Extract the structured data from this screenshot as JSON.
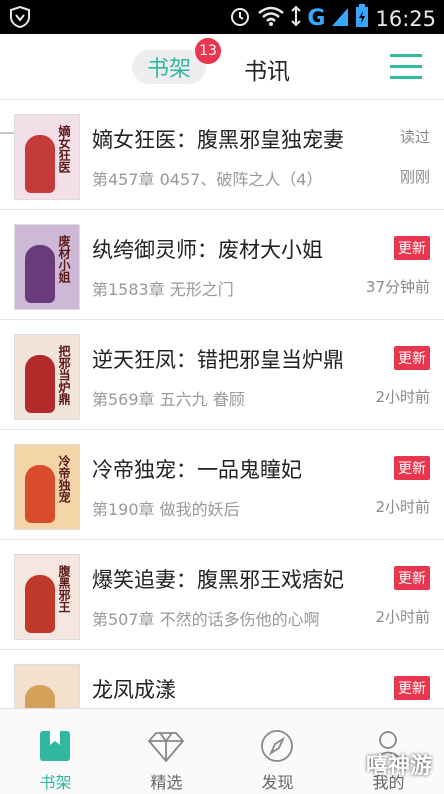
{
  "status_bar": {
    "time": "16:25",
    "network": "G"
  },
  "header": {
    "tab_shelf": "书架",
    "tab_shelf_badge": "13",
    "tab_news": "书讯"
  },
  "books": [
    {
      "title": "嫡女狂医：腹黑邪皇独宠妻",
      "chapter": "第457章 0457、破阵之人（4）",
      "tag": "读过",
      "tag_type": "read",
      "time": "刚刚",
      "cover_text": "嫡女狂医",
      "cover_color": "#f3dfe7"
    },
    {
      "title": "纨绔御灵师：废材大小姐",
      "chapter": "第1583章 无形之门",
      "tag": "更新",
      "tag_type": "new",
      "time": "37分钟前",
      "cover_text": "废材小姐",
      "cover_color": "#cdb8d6"
    },
    {
      "title": "逆天狂凤：错把邪皇当炉鼎",
      "chapter": "第569章 五六九 眷顾",
      "tag": "更新",
      "tag_type": "new",
      "time": "2小时前",
      "cover_text": "把邪当炉鼎",
      "cover_color": "#f2e3db"
    },
    {
      "title": "冷帝独宠：一品鬼瞳妃",
      "chapter": "第190章 做我的妖后",
      "tag": "更新",
      "tag_type": "new",
      "time": "2小时前",
      "cover_text": "冷帝独宠",
      "cover_color": "#f3d5a8"
    },
    {
      "title": "爆笑追妻：腹黑邪王戏痞妃",
      "chapter": "第507章 不然的话多伤他的心啊",
      "tag": "更新",
      "tag_type": "new",
      "time": "2小时前",
      "cover_text": "腹黑邪王",
      "cover_color": "#f6e6e0"
    },
    {
      "title": "龙凤成漾",
      "chapter": "",
      "tag": "更新",
      "tag_type": "new",
      "time": "",
      "cover_text": "",
      "cover_color": "#f3e0cf"
    }
  ],
  "bottom_nav": [
    {
      "label": "书架",
      "icon": "bookmark-icon",
      "active": true
    },
    {
      "label": "精选",
      "icon": "diamond-icon",
      "active": false
    },
    {
      "label": "发现",
      "icon": "compass-icon",
      "active": false
    },
    {
      "label": "我的",
      "icon": "user-icon",
      "active": false
    }
  ],
  "watermark": "嘻神游",
  "colors": {
    "accent": "#33b8a0",
    "badge": "#e8364f"
  }
}
